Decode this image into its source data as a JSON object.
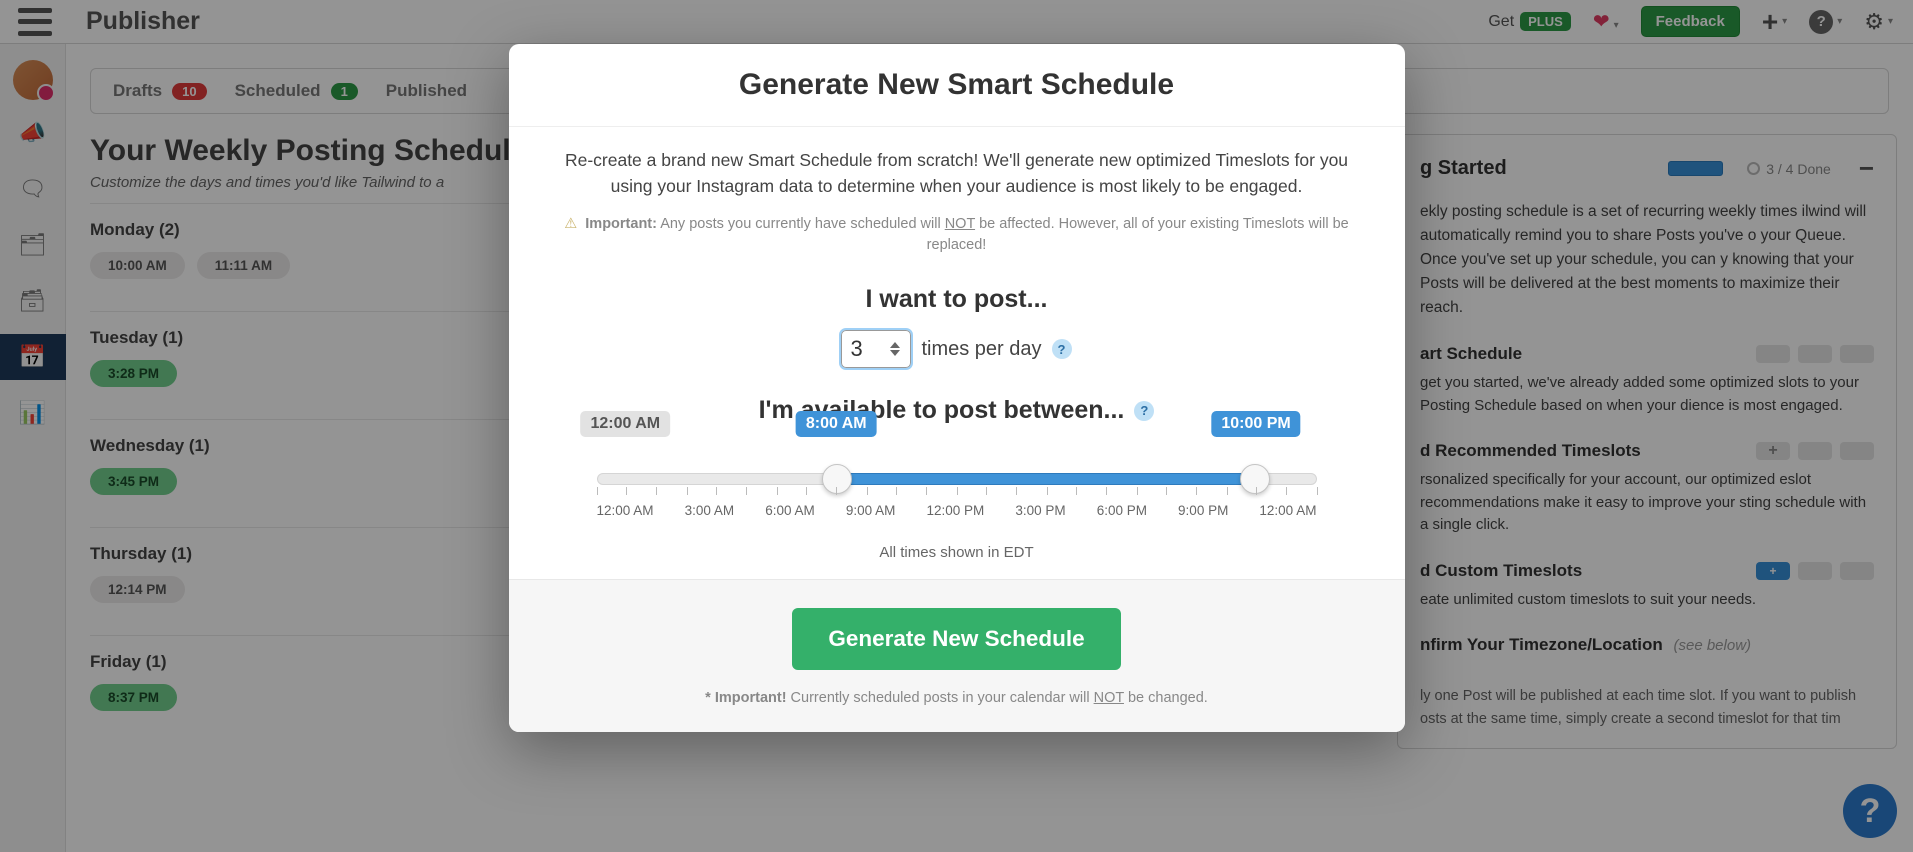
{
  "topbar": {
    "title": "Publisher",
    "get_label": "Get",
    "plus_label": "PLUS",
    "feedback_label": "Feedback"
  },
  "tabs": {
    "drafts_label": "Drafts",
    "drafts_count": "10",
    "scheduled_label": "Scheduled",
    "scheduled_count": "1",
    "published_label": "Published"
  },
  "schedule": {
    "title": "Your Weekly Posting Schedule",
    "sub": "Customize the days and times you'd like Tailwind to a",
    "days": {
      "mon_head": "Monday (2)",
      "mon_t1": "10:00 AM",
      "mon_t2": "11:11 AM",
      "tue_head": "Tuesday (1)",
      "tue_t1": "3:28 PM",
      "wed_head": "Wednesday (1)",
      "wed_t1": "3:45 PM",
      "thu_head": "Thursday (1)",
      "thu_t1": "12:14 PM",
      "fri_head": "Friday (1)",
      "fri_t1": "8:37 PM"
    }
  },
  "side": {
    "head": "g Started",
    "prog_label": "3 / 4 Done",
    "desc": "ekly posting schedule is a set of recurring weekly times ilwind will automatically remind you to share Posts you've o your Queue. Once you've set up your schedule, you can y knowing that your Posts will be delivered at the best moments to maximize their reach.",
    "s1_head": "art Schedule",
    "s1_body": "get you started, we've already added some optimized slots to your Posting Schedule based on when your dience is most engaged.",
    "s2_head": "d Recommended Timeslots",
    "s2_body": "rsonalized specifically for your account, our optimized eslot recommendations make it easy to improve your sting schedule with a single click.",
    "s2_plus": "+",
    "s3_head": "d Custom Timeslots",
    "s3_body": "eate unlimited custom timeslots to suit your needs.",
    "s3_plus": "+",
    "s4_head": "nfirm Your Timezone/Location",
    "s4_hint": "(see below)",
    "note": "ly one Post will be published at each time slot. If you want to publish osts at the same time, simply create a second timeslot for that tim"
  },
  "modal": {
    "title": "Generate New Smart Schedule",
    "lead": "Re-create a brand new Smart Schedule from scratch! We'll generate new optimized Timeslots for you using your Instagram data to determine when your audience is most likely to be engaged.",
    "warn_label": "Important:",
    "warn_text1": " Any posts you currently have scheduled will ",
    "warn_not": "NOT",
    "warn_text2": " be affected. However, all of your existing Timeslots will be replaced!",
    "post_label": "I want to post...",
    "post_value": "3",
    "post_suffix": "times per day",
    "avail_label": "I'm available to post between...",
    "slider": {
      "left_bubble": "12:00 AM",
      "start_bubble": "8:00 AM",
      "end_bubble": "10:00 PM"
    },
    "tick_labels": [
      "12:00 AM",
      "3:00 AM",
      "6:00 AM",
      "9:00 AM",
      "12:00 PM",
      "3:00 PM",
      "6:00 PM",
      "9:00 PM",
      "12:00 AM"
    ],
    "tz_hint": "All times shown in EDT",
    "button": "Generate New Schedule",
    "foot_label": "* Important!",
    "foot_text1": " Currently scheduled posts in your calendar will ",
    "foot_not": "NOT",
    "foot_text2": " be changed."
  }
}
